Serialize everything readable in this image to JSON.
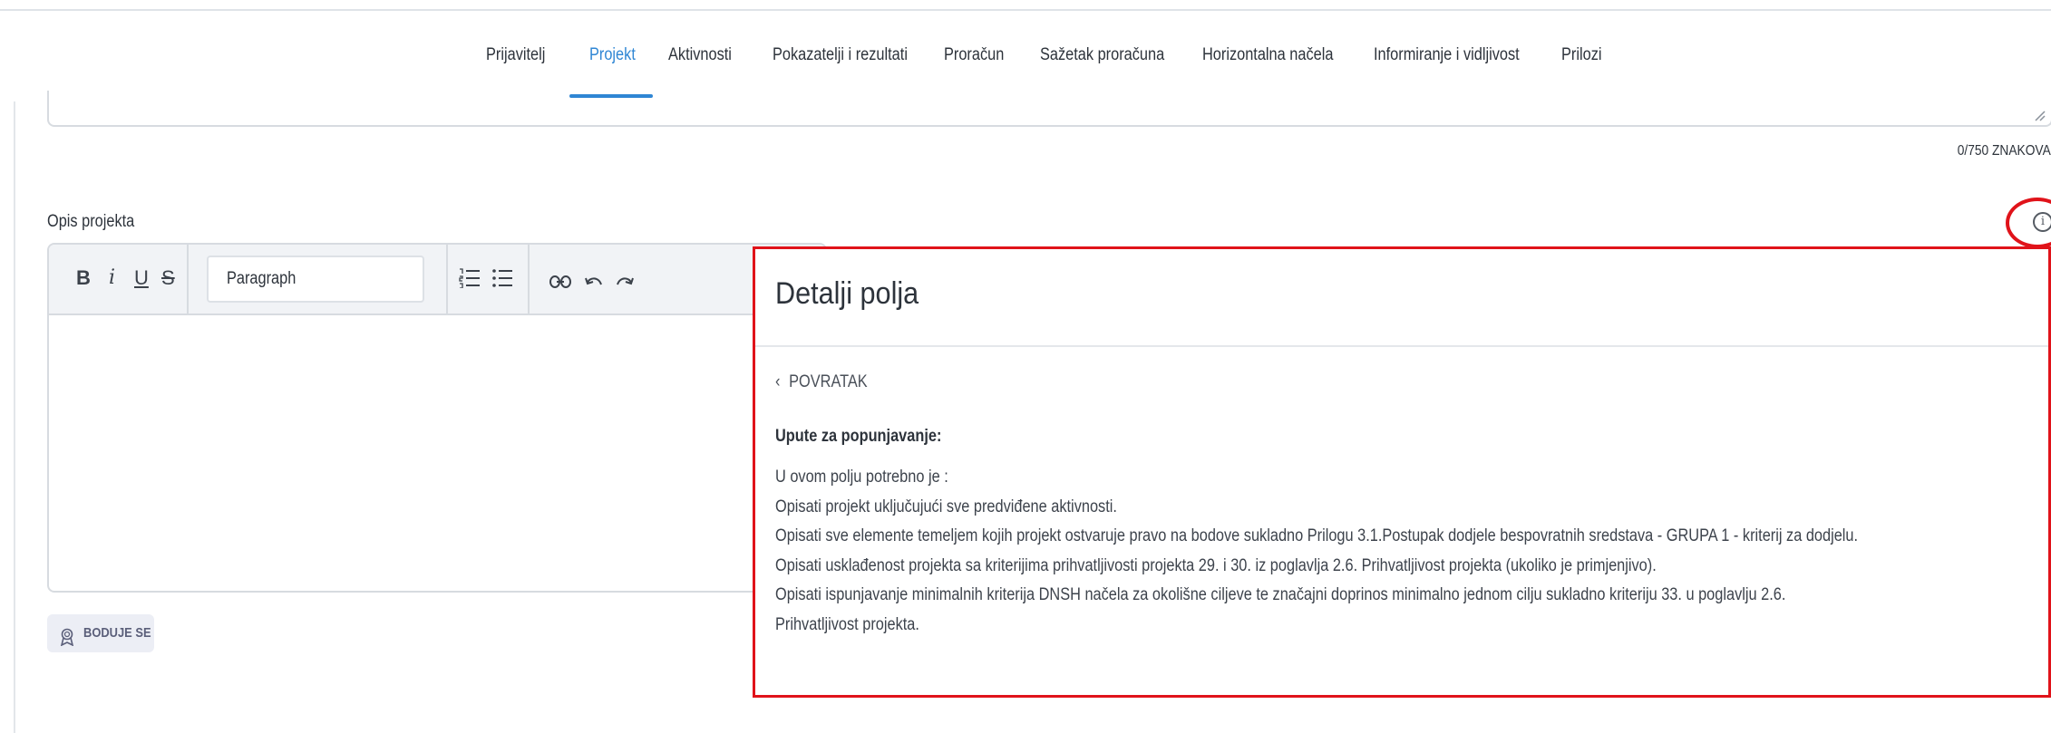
{
  "tabs": [
    {
      "label": "Prijavitelj",
      "active": false
    },
    {
      "label": "Projekt",
      "active": true
    },
    {
      "label": "Aktivnosti",
      "active": false
    },
    {
      "label": "Pokazatelji i rezultati",
      "active": false
    },
    {
      "label": "Proračun",
      "active": false
    },
    {
      "label": "Sažetak proračuna",
      "active": false
    },
    {
      "label": "Horizontalna načela",
      "active": false
    },
    {
      "label": "Informiranje i vidljivost",
      "active": false
    },
    {
      "label": "Prilozi",
      "active": false
    }
  ],
  "previous_field": {
    "char_count": "0/750 ZNAKOVA"
  },
  "field": {
    "label": "Opis projekta",
    "info_icon": "info-icon"
  },
  "editor": {
    "toolbar": {
      "bold": "B",
      "italic": "i",
      "underline": "U",
      "strikethrough": "S",
      "paragraph_select": "Paragraph"
    },
    "content": ""
  },
  "score_badge": {
    "label": "BODUJE SE",
    "icon": "award-icon"
  },
  "details_panel": {
    "title": "Detalji polja",
    "back_label": "POVRATAK",
    "instructions_heading": "Upute za popunjavanje:",
    "instructions": [
      "U ovom polju potrebno je :",
      "Opisati projekt uključujući sve predviđene aktivnosti.",
      "Opisati sve elemente temeljem kojih projekt ostvaruje pravo na bodove sukladno Prilogu 3.1.Postupak dodjele bespovratnih sredstava - GRUPA 1 - kriterij za dodjelu.",
      "Opisati usklađenost projekta sa kriterijima prihvatljivosti projekta 29. i 30. iz poglavlja 2.6. Prihvatljivost projekta (ukoliko je primjenjivo).",
      "Opisati ispunjavanje minimalnih kriterija DNSH načela za okolišne ciljeve te značajni doprinos minimalno jednom cilju sukladno kriteriju 33. u poglavlju 2.6.",
      "Prihvatljivost projekta."
    ]
  },
  "colors": {
    "accent": "#2f86d4",
    "highlight": "#e0131a",
    "border": "#d7dbe0"
  }
}
